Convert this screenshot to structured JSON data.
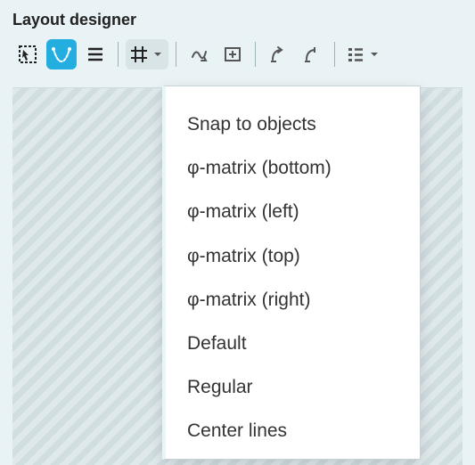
{
  "panel": {
    "title": "Layout designer"
  },
  "toolbar": {
    "icons": {
      "select": "selection-rect-icon",
      "curve": "curve-tool-icon",
      "lines": "align-lines-icon",
      "grid": "grid-icon",
      "path": "freehand-path-icon",
      "frame": "frame-tool-icon",
      "transform1": "rotate-tool-icon",
      "transform2": "scale-tool-icon",
      "list": "list-view-icon"
    }
  },
  "grid_menu": {
    "items": [
      "Snap to objects",
      "φ-matrix (bottom)",
      "φ-matrix (left)",
      "φ-matrix (top)",
      "φ-matrix (right)",
      "Default",
      "Regular",
      "Center lines"
    ]
  }
}
